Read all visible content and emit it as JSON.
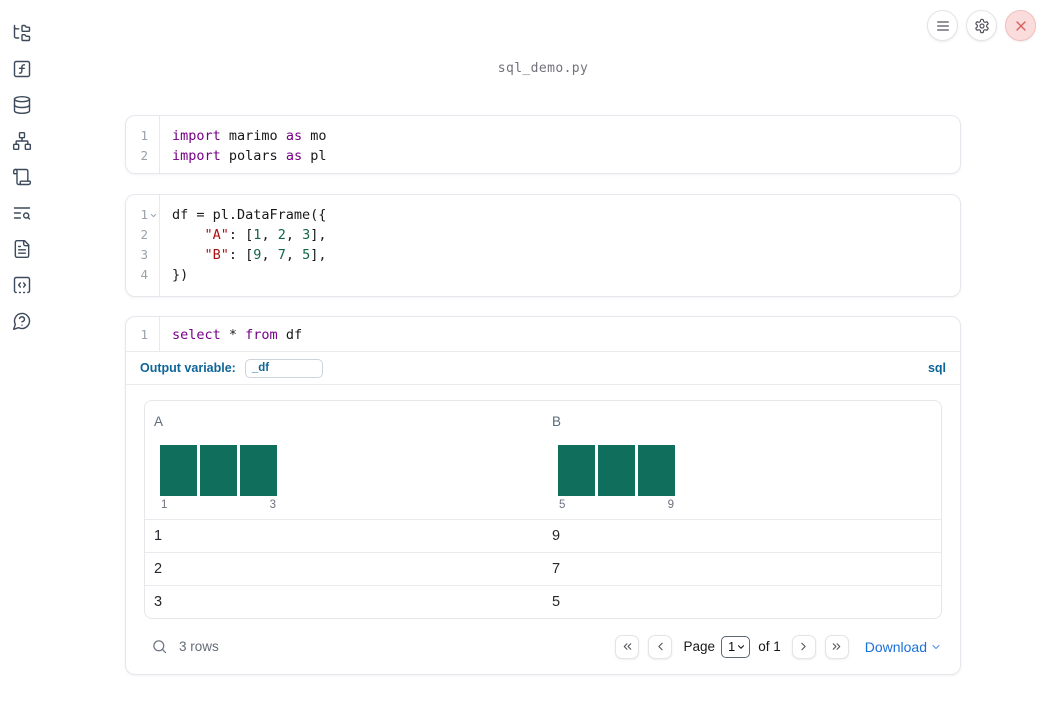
{
  "window": {
    "title": "sql_demo.py"
  },
  "topbar": {
    "buttons": [
      {
        "name": "menu",
        "icon": "hamburger-icon"
      },
      {
        "name": "settings",
        "icon": "gear-icon"
      },
      {
        "name": "shutdown",
        "icon": "close-icon"
      }
    ]
  },
  "sidebar": {
    "items": [
      {
        "icon": "file-explorer-tree-icon"
      },
      {
        "icon": "variables-function-icon"
      },
      {
        "icon": "datasources-database-icon"
      },
      {
        "icon": "dependency-graph-icon"
      },
      {
        "icon": "logs-scroll-icon"
      },
      {
        "icon": "outline-search-icon"
      },
      {
        "icon": "documentation-file-icon"
      },
      {
        "icon": "scratchpad-code-icon"
      },
      {
        "icon": "help-chat-icon"
      }
    ]
  },
  "cells": [
    {
      "id": "cell-imports",
      "language": "python",
      "lines": [
        {
          "num": "1",
          "tokens": [
            {
              "c": "kw",
              "t": "import"
            },
            {
              "c": "pl",
              "t": " marimo "
            },
            {
              "c": "kw",
              "t": "as"
            },
            {
              "c": "pl",
              "t": " mo"
            }
          ]
        },
        {
          "num": "2",
          "tokens": [
            {
              "c": "kw",
              "t": "import"
            },
            {
              "c": "pl",
              "t": " polars "
            },
            {
              "c": "kw",
              "t": "as"
            },
            {
              "c": "pl",
              "t": " pl"
            }
          ]
        }
      ]
    },
    {
      "id": "cell-dataframe",
      "language": "python",
      "lines": [
        {
          "num": "1",
          "fold": true,
          "tokens": [
            {
              "c": "pl",
              "t": "df = pl.DataFrame({"
            }
          ]
        },
        {
          "num": "2",
          "tokens": [
            {
              "c": "pl",
              "t": "    "
            },
            {
              "c": "str",
              "t": "\"A\""
            },
            {
              "c": "pl",
              "t": ": ["
            },
            {
              "c": "num",
              "t": "1"
            },
            {
              "c": "pl",
              "t": ", "
            },
            {
              "c": "num",
              "t": "2"
            },
            {
              "c": "pl",
              "t": ", "
            },
            {
              "c": "num",
              "t": "3"
            },
            {
              "c": "pl",
              "t": "],"
            }
          ]
        },
        {
          "num": "3",
          "tokens": [
            {
              "c": "pl",
              "t": "    "
            },
            {
              "c": "str",
              "t": "\"B\""
            },
            {
              "c": "pl",
              "t": ": ["
            },
            {
              "c": "num",
              "t": "9"
            },
            {
              "c": "pl",
              "t": ", "
            },
            {
              "c": "num",
              "t": "7"
            },
            {
              "c": "pl",
              "t": ", "
            },
            {
              "c": "num",
              "t": "5"
            },
            {
              "c": "pl",
              "t": "],"
            }
          ]
        },
        {
          "num": "4",
          "tokens": [
            {
              "c": "pl",
              "t": "})"
            }
          ]
        }
      ]
    },
    {
      "id": "cell-sql",
      "language": "sql",
      "lines": [
        {
          "num": "1",
          "tokens": [
            {
              "c": "kw",
              "t": "select"
            },
            {
              "c": "pl",
              "t": " * "
            },
            {
              "c": "kw",
              "t": "from"
            },
            {
              "c": "pl",
              "t": " df"
            }
          ]
        }
      ]
    }
  ],
  "sql_meta": {
    "output_variable_label": "Output variable:",
    "output_variable_value": "_df",
    "language_badge": "sql"
  },
  "table": {
    "columns": [
      {
        "name": "A",
        "hist_min_label": "1",
        "hist_max_label": "3",
        "hist_bars": [
          1,
          1,
          1
        ]
      },
      {
        "name": "B",
        "hist_min_label": "5",
        "hist_max_label": "9",
        "hist_bars": [
          1,
          1,
          1
        ]
      }
    ],
    "rows": [
      [
        "1",
        "9"
      ],
      [
        "2",
        "7"
      ],
      [
        "3",
        "5"
      ]
    ],
    "footer": {
      "row_count": "3 rows",
      "page_label": "Page",
      "page_value": "1",
      "of_label": "of 1",
      "download_label": "Download"
    }
  },
  "colors": {
    "keyword": "#770088",
    "string": "#aa1111",
    "number": "#116644",
    "hist_bar": "#0f6e5c",
    "accent_blue": "#0e6598",
    "link_blue": "#1a70d9"
  }
}
